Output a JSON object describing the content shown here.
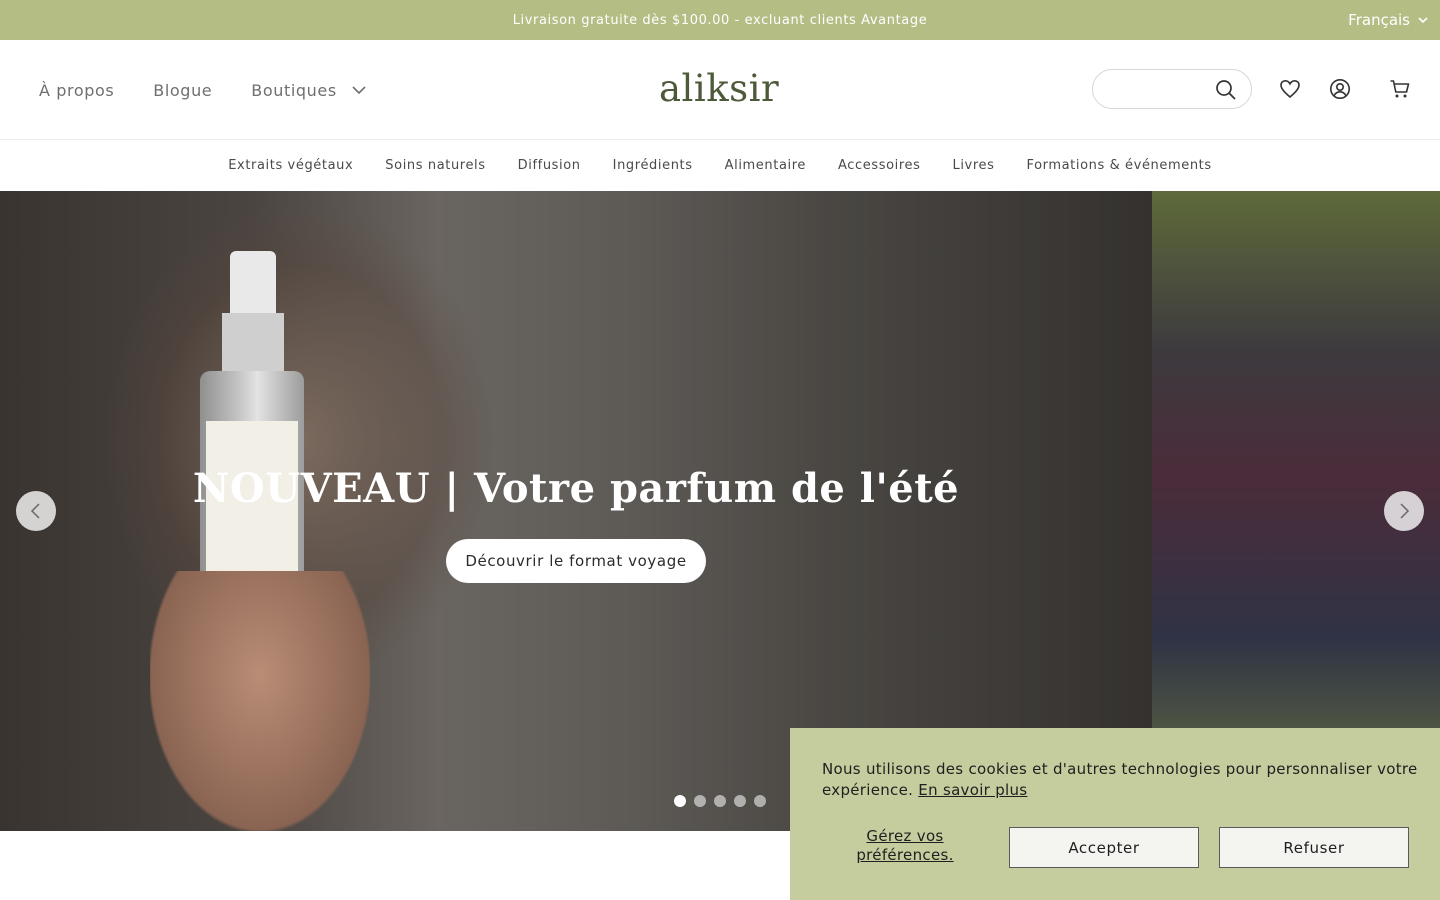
{
  "announcement": {
    "text": "Livraison gratuite dès $100.00 - excluant clients Avantage"
  },
  "language": {
    "label": "Français",
    "icon": "chevron-down-icon"
  },
  "header": {
    "nav": [
      {
        "label": "À propos"
      },
      {
        "label": "Blogue"
      },
      {
        "label": "Boutiques",
        "icon": "chevron-down-icon"
      }
    ],
    "logo": "aliksir",
    "search": {
      "placeholder": "",
      "value": "",
      "icon": "search-icon"
    },
    "icons": [
      "heart-icon",
      "user-icon",
      "cart-icon"
    ]
  },
  "categories": [
    "Extraits végétaux",
    "Soins naturels",
    "Diffusion",
    "Ingrédients",
    "Alimentaire",
    "Accessoires",
    "Livres",
    "Formations & événements"
  ],
  "hero": {
    "title": "NOUVEAU | Votre parfum de l'été",
    "cta": "Découvrir le format voyage",
    "slide_count": 5,
    "active_slide": 1,
    "prev_icon": "chevron-left-icon",
    "next_icon": "chevron-right-icon"
  },
  "cookie": {
    "message": "Nous utilisons des cookies et d'autres technologies pour personnaliser votre expérience.",
    "learn_more": "En savoir plus",
    "preferences": "Gérez vos préférences.",
    "accept": "Accepter",
    "refuse": "Refuser"
  },
  "colors": {
    "brand_green": "#b3bd84",
    "cookie_bg": "#c5cc9e",
    "logo": "#4d5a3a"
  }
}
